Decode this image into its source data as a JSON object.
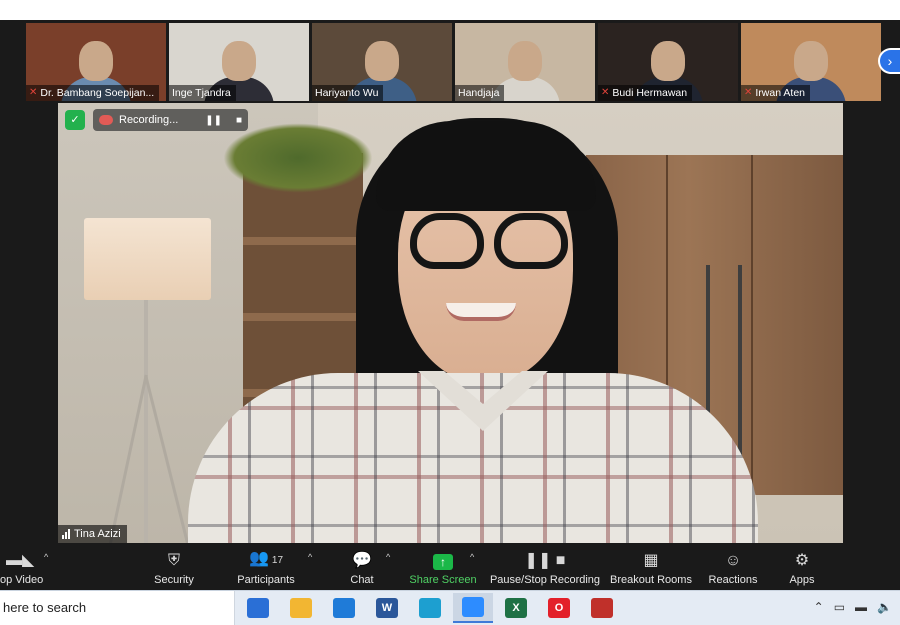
{
  "participants_strip": [
    {
      "name": "Dr. Bambang Soepijan...",
      "muted": true,
      "bg": "#7a3f2a",
      "shirt": "#6a8bb0"
    },
    {
      "name": "Inge Tjandra",
      "muted": false,
      "bg": "#d9d6cf",
      "shirt": "#2d2d36"
    },
    {
      "name": "Hariyanto Wu",
      "muted": false,
      "bg": "#5c4a3a",
      "shirt": "#3e5f86"
    },
    {
      "name": "Handjaja",
      "muted": false,
      "bg": "#c7b7a2",
      "shirt": "#d8d4cc"
    },
    {
      "name": "Budi Hermawan",
      "muted": true,
      "bg": "#2b2320",
      "shirt": "#1f2430"
    },
    {
      "name": "Irwan Aten",
      "muted": true,
      "bg": "#bf8a5c",
      "shirt": "#3a4f78"
    }
  ],
  "next_page_icon": "chevron-right-icon",
  "recording": {
    "label": "Recording...",
    "pause_icon": "pause-icon",
    "stop_icon": "stop-icon"
  },
  "active_speaker": {
    "name": "Tina Azizi"
  },
  "toolbar": {
    "stop_video": "op Video",
    "security": "Security",
    "participants": "Participants",
    "participants_count": "17",
    "chat": "Chat",
    "share_screen": "Share Screen",
    "pause_stop_recording": "Pause/Stop Recording",
    "breakout_rooms": "Breakout Rooms",
    "reactions": "Reactions",
    "apps": "Apps"
  },
  "taskbar": {
    "search_text": "here to search",
    "apps": [
      {
        "name": "chrome-icon",
        "color": "#2a6fd6"
      },
      {
        "name": "file-explorer-icon",
        "color": "#f2b632"
      },
      {
        "name": "mail-icon",
        "color": "#1f7bd8"
      },
      {
        "name": "word-icon",
        "color": "#2b579a",
        "glyph": "W"
      },
      {
        "name": "edge-icon",
        "color": "#1d9fd0"
      },
      {
        "name": "zoom-icon",
        "color": "#2d8cff"
      },
      {
        "name": "excel-icon",
        "color": "#1e7145",
        "glyph": "X"
      },
      {
        "name": "opera-icon",
        "color": "#e3202a",
        "glyph": "O"
      },
      {
        "name": "app-icon",
        "color": "#c0302a"
      }
    ]
  },
  "colors": {
    "accent_green": "#4fd164",
    "muted_red": "#e0433a",
    "toolbar_bg": "#1a1a1a"
  }
}
